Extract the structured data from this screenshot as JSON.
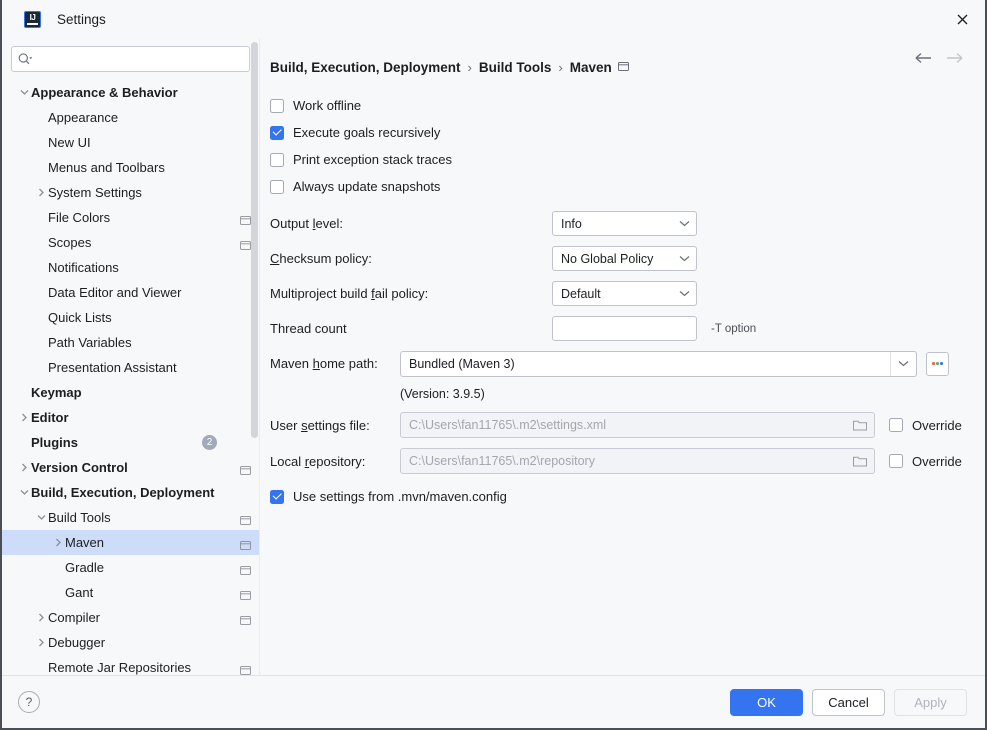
{
  "window": {
    "title": "Settings",
    "logo_text": "IJ",
    "close_icon": "close-icon"
  },
  "sidebar": {
    "search": {
      "value": "",
      "placeholder": ""
    },
    "items": [
      {
        "label": "Appearance & Behavior",
        "indent": 0,
        "twisty": "down",
        "bold": true,
        "mod": false,
        "badge": ""
      },
      {
        "label": "Appearance",
        "indent": 1,
        "twisty": "",
        "bold": false,
        "mod": false,
        "badge": ""
      },
      {
        "label": "New UI",
        "indent": 1,
        "twisty": "",
        "bold": false,
        "mod": false,
        "badge": ""
      },
      {
        "label": "Menus and Toolbars",
        "indent": 1,
        "twisty": "",
        "bold": false,
        "mod": false,
        "badge": ""
      },
      {
        "label": "System Settings",
        "indent": 1,
        "twisty": "right",
        "bold": false,
        "mod": false,
        "badge": ""
      },
      {
        "label": "File Colors",
        "indent": 1,
        "twisty": "",
        "bold": false,
        "mod": true,
        "badge": ""
      },
      {
        "label": "Scopes",
        "indent": 1,
        "twisty": "",
        "bold": false,
        "mod": true,
        "badge": ""
      },
      {
        "label": "Notifications",
        "indent": 1,
        "twisty": "",
        "bold": false,
        "mod": false,
        "badge": ""
      },
      {
        "label": "Data Editor and Viewer",
        "indent": 1,
        "twisty": "",
        "bold": false,
        "mod": false,
        "badge": ""
      },
      {
        "label": "Quick Lists",
        "indent": 1,
        "twisty": "",
        "bold": false,
        "mod": false,
        "badge": ""
      },
      {
        "label": "Path Variables",
        "indent": 1,
        "twisty": "",
        "bold": false,
        "mod": false,
        "badge": ""
      },
      {
        "label": "Presentation Assistant",
        "indent": 1,
        "twisty": "",
        "bold": false,
        "mod": false,
        "badge": ""
      },
      {
        "label": "Keymap",
        "indent": 0,
        "twisty": "",
        "bold": true,
        "mod": false,
        "badge": ""
      },
      {
        "label": "Editor",
        "indent": 0,
        "twisty": "right",
        "bold": true,
        "mod": false,
        "badge": ""
      },
      {
        "label": "Plugins",
        "indent": 0,
        "twisty": "",
        "bold": true,
        "mod": false,
        "badge": "2"
      },
      {
        "label": "Version Control",
        "indent": 0,
        "twisty": "right",
        "bold": true,
        "mod": true,
        "badge": ""
      },
      {
        "label": "Build, Execution, Deployment",
        "indent": 0,
        "twisty": "down",
        "bold": true,
        "mod": false,
        "badge": ""
      },
      {
        "label": "Build Tools",
        "indent": 1,
        "twisty": "down",
        "bold": false,
        "mod": true,
        "badge": ""
      },
      {
        "label": "Maven",
        "indent": 2,
        "twisty": "right",
        "bold": false,
        "mod": true,
        "badge": "",
        "selected": true
      },
      {
        "label": "Gradle",
        "indent": 2,
        "twisty": "",
        "bold": false,
        "mod": true,
        "badge": ""
      },
      {
        "label": "Gant",
        "indent": 2,
        "twisty": "",
        "bold": false,
        "mod": true,
        "badge": ""
      },
      {
        "label": "Compiler",
        "indent": 1,
        "twisty": "right",
        "bold": false,
        "mod": true,
        "badge": ""
      },
      {
        "label": "Debugger",
        "indent": 1,
        "twisty": "right",
        "bold": false,
        "mod": false,
        "badge": ""
      },
      {
        "label": "Remote Jar Repositories",
        "indent": 1,
        "twisty": "",
        "bold": false,
        "mod": true,
        "badge": ""
      }
    ]
  },
  "content": {
    "breadcrumb": [
      "Build, Execution, Deployment",
      "Build Tools",
      "Maven"
    ],
    "breadcrumb_separator": "›",
    "nav": {
      "back_icon": "arrow-left-icon",
      "forward_icon": "arrow-right-icon"
    },
    "checkboxes": [
      {
        "label": "Work offline",
        "checked": false
      },
      {
        "label": "Execute goals recursively",
        "checked": true
      },
      {
        "label": "Print exception stack traces",
        "checked": false
      },
      {
        "label": "Always update snapshots",
        "checked": false
      }
    ],
    "output_level": {
      "label_pre": "Output ",
      "label_mnemonic": "l",
      "label_post": "evel:",
      "value": "Info"
    },
    "checksum_policy": {
      "label_pre": "",
      "label_mnemonic": "C",
      "label_post": "hecksum policy:",
      "value": "No Global Policy"
    },
    "fail_policy": {
      "label_pre": "Multiproject build ",
      "label_mnemonic": "f",
      "label_post": "ail policy:",
      "value": "Default"
    },
    "thread_count": {
      "label": "Thread count",
      "value": "",
      "hint": "-T option"
    },
    "maven_home": {
      "label_pre": "Maven ",
      "label_mnemonic": "h",
      "label_post": "ome path:",
      "value": "Bundled (Maven 3)",
      "browse_icon": "ellipsis-icon"
    },
    "version_line": "(Version: 3.9.5)",
    "user_settings": {
      "label_pre": "User ",
      "label_mnemonic": "s",
      "label_post": "ettings file:",
      "value": "C:\\Users\\fan11765\\.m2\\settings.xml",
      "folder_icon": "folder-icon",
      "override_label": "Override",
      "override_checked": false
    },
    "local_repository": {
      "label_pre": "Local ",
      "label_mnemonic": "r",
      "label_post": "epository:",
      "value": "C:\\Users\\fan11765\\.m2\\repository",
      "folder_icon": "folder-icon",
      "override_label": "Override",
      "override_checked": false
    },
    "use_mvn_config": {
      "label": "Use settings from .mvn/maven.config",
      "checked": true
    }
  },
  "footer": {
    "help_label": "?",
    "ok_label": "OK",
    "cancel_label": "Cancel",
    "apply_label": "Apply"
  },
  "colors": {
    "accent": "#3574f0",
    "selection": "#cddcf8",
    "background": "#f7f8fa",
    "badge": "#a1a9bb"
  }
}
